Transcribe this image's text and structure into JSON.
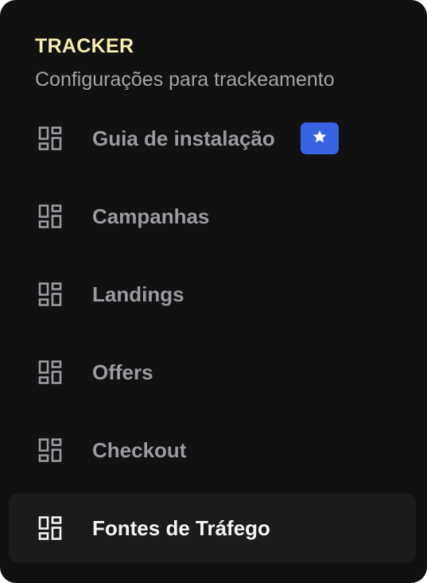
{
  "header": {
    "title": "TRACKER",
    "subtitle": "Configurações para trackeamento"
  },
  "menu": {
    "items": [
      {
        "label": "Guia de instalação",
        "icon": "dashboard-icon",
        "badge_icon": "star-icon",
        "active": false
      },
      {
        "label": "Campanhas",
        "icon": "dashboard-icon",
        "active": false
      },
      {
        "label": "Landings",
        "icon": "dashboard-icon",
        "active": false
      },
      {
        "label": "Offers",
        "icon": "dashboard-icon",
        "active": false
      },
      {
        "label": "Checkout",
        "icon": "dashboard-icon",
        "active": false
      },
      {
        "label": "Fontes de Tráfego",
        "icon": "dashboard-icon",
        "active": true
      }
    ]
  },
  "colors": {
    "panel_background": "#111112",
    "title": "#f5ecb0",
    "subtitle": "#a3a3a7",
    "item_text": "#9a9aa0",
    "item_text_active": "#f4f4f5",
    "active_background": "#1b1b1d",
    "badge": "#3864e3"
  }
}
